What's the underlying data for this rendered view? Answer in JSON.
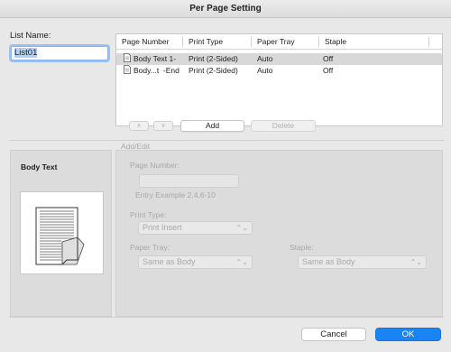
{
  "window": {
    "title": "Per Page Setting"
  },
  "list_name": {
    "label": "List Name:",
    "value": "List01"
  },
  "table": {
    "columns": [
      "Page Number",
      "Print Type",
      "Paper Tray",
      "Staple"
    ],
    "rows": [
      {
        "page_number": "Body Text 1-",
        "print_type": "Print (2-Sided)",
        "paper_tray": "Auto",
        "staple": "Off",
        "selected": true
      },
      {
        "page_number": "Body...t  -End",
        "print_type": "Print (2-Sided)",
        "paper_tray": "Auto",
        "staple": "Off",
        "selected": false
      }
    ]
  },
  "list_controls": {
    "move_up": "∧",
    "move_down": "∨",
    "add": "Add",
    "delete": "Delete"
  },
  "add_edit": {
    "section_label": "Add/Edit",
    "body_text_label": "Body Text",
    "page_number_label": "Page Number:",
    "entry_example": "Entry Example 2,4,6-10",
    "print_type_label": "Print Type:",
    "print_type_value": "Print Insert",
    "paper_tray_label": "Paper Tray:",
    "paper_tray_value": "Same as Body",
    "staple_label": "Staple:",
    "staple_value": "Same as Body"
  },
  "footer": {
    "cancel": "Cancel",
    "ok": "OK"
  },
  "colors": {
    "accent": "#1a84f4",
    "selected_row": "#d8d8d8",
    "disabled_text": "#a8a8a8"
  }
}
